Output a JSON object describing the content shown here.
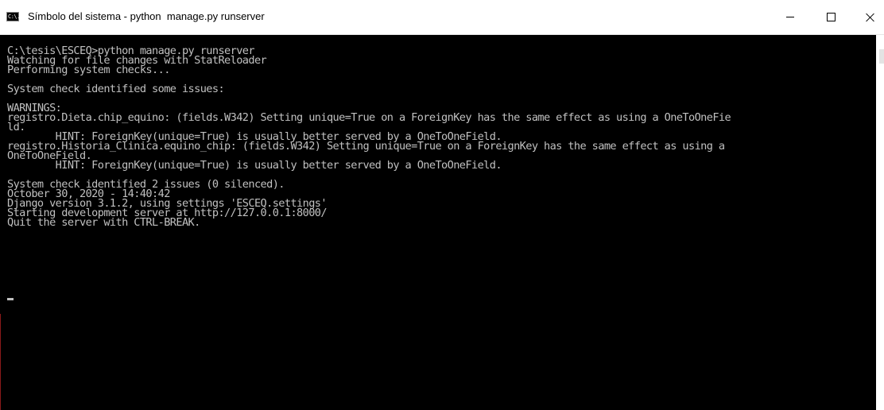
{
  "window": {
    "title": "Símbolo del sistema - python  manage.py runserver",
    "app_icon_glyph": "C:\\."
  },
  "controls": {
    "minimize": "minimize",
    "maximize": "maximize",
    "close": "close"
  },
  "console": {
    "lines": [
      "C:\\tesis\\ESCEQ>python manage.py runserver",
      "Watching for file changes with StatReloader",
      "Performing system checks...",
      "",
      "System check identified some issues:",
      "",
      "WARNINGS:",
      "registro.Dieta.chip_equino: (fields.W342) Setting unique=True on a ForeignKey has the same effect as using a OneToOneFie",
      "ld.",
      "        HINT: ForeignKey(unique=True) is usually better served by a OneToOneField.",
      "registro.Historia_Clinica.equino_chip: (fields.W342) Setting unique=True on a ForeignKey has the same effect as using a",
      "OneToOneField.",
      "        HINT: ForeignKey(unique=True) is usually better served by a OneToOneField.",
      "",
      "System check identified 2 issues (0 silenced).",
      "October 30, 2020 - 14:40:42",
      "Django version 3.1.2, using settings 'ESCEQ.settings'",
      "Starting development server at http://127.0.0.1:8000/",
      "Quit the server with CTRL-BREAK."
    ],
    "colors": {
      "background": "#000000",
      "text": "#c0c0c0"
    }
  }
}
